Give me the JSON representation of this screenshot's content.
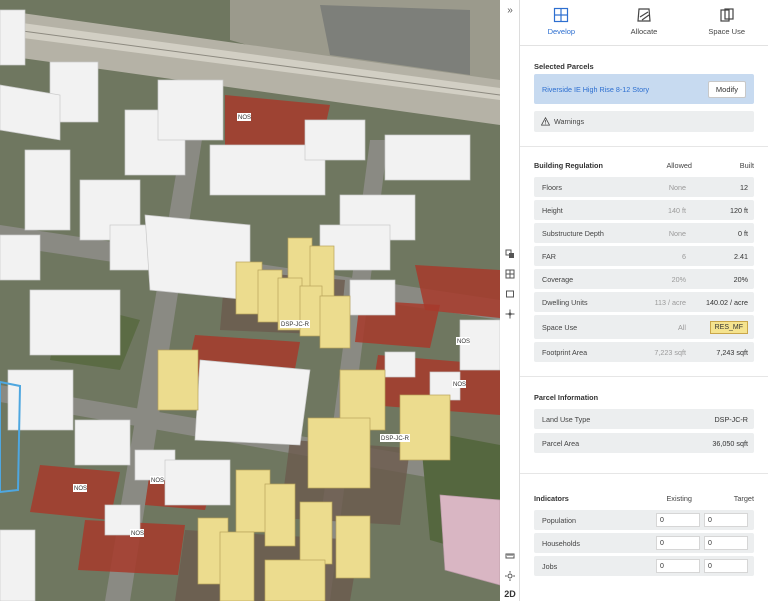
{
  "tabs": [
    {
      "label": "Develop",
      "icon": "develop-icon",
      "active": true
    },
    {
      "label": "Allocate",
      "icon": "allocate-icon",
      "active": false
    },
    {
      "label": "Space Use",
      "icon": "space-use-icon",
      "active": false
    }
  ],
  "selected_parcels": {
    "title": "Selected Parcels",
    "name": "Riverside IE High Rise 8-12 Story",
    "modify_label": "Modify",
    "warnings_label": "Warnings"
  },
  "building_regulation": {
    "title": "Building Regulation",
    "allowed_header": "Allowed",
    "built_header": "Built",
    "rows": [
      {
        "label": "Floors",
        "allowed": "None",
        "built": "12"
      },
      {
        "label": "Height",
        "allowed": "140 ft",
        "built": "120 ft"
      },
      {
        "label": "Substructure Depth",
        "allowed": "None",
        "built": "0 ft"
      },
      {
        "label": "FAR",
        "allowed": "6",
        "built": "2.41"
      },
      {
        "label": "Coverage",
        "allowed": "20%",
        "built": "20%"
      },
      {
        "label": "Dwelling Units",
        "allowed": "113 / acre",
        "built": "140.02 / acre"
      },
      {
        "label": "Space Use",
        "allowed": "All",
        "built": "RES_MF"
      },
      {
        "label": "Footprint Area",
        "allowed": "7,223 sqft",
        "built": "7,243 sqft"
      }
    ]
  },
  "parcel_information": {
    "title": "Parcel Information",
    "rows": [
      {
        "label": "Land Use Type",
        "value": "DSP-JC-R"
      },
      {
        "label": "Parcel Area",
        "value": "36,050 sqft"
      }
    ]
  },
  "indicators": {
    "title": "Indicators",
    "existing_header": "Existing",
    "target_header": "Target",
    "rows": [
      {
        "label": "Population",
        "existing": "0",
        "target": "0"
      },
      {
        "label": "Households",
        "existing": "0",
        "target": "0"
      },
      {
        "label": "Jobs",
        "existing": "0",
        "target": "0"
      }
    ]
  },
  "map": {
    "labels": [
      "NOS",
      "DSP-JC-R",
      "NOS",
      "NOS",
      "DSP-JC-R",
      "NOS",
      "NOS",
      "NOS"
    ],
    "colors": {
      "parcel_red": "#a7392c",
      "proposed_building": "#ecdc8e",
      "existing_building": "#f2f2f2",
      "selected_outline": "#4ea7e0"
    }
  },
  "toolbar": {
    "collapse_glyph": "»",
    "mode_label": "2D",
    "icons": [
      "layer-swap-icon",
      "grid-icon",
      "frame-icon",
      "move-icon",
      "ruler-icon",
      "sun-icon"
    ]
  }
}
